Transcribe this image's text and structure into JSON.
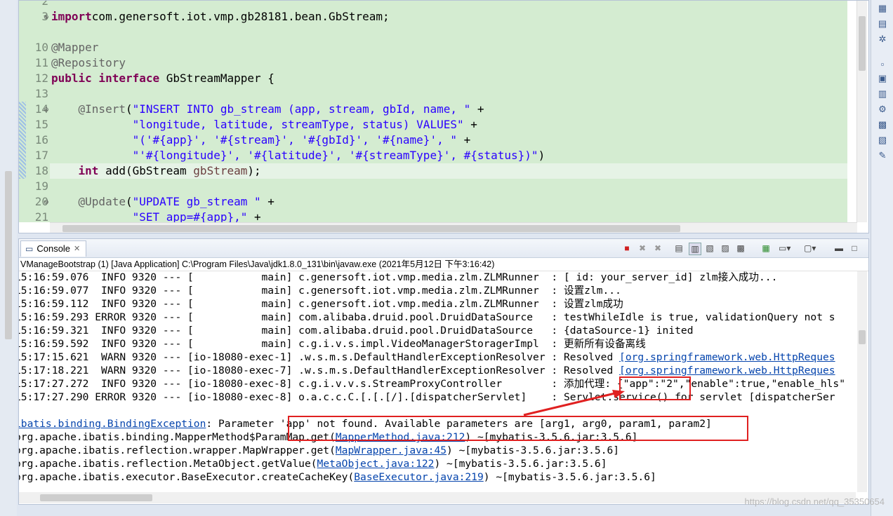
{
  "editor": {
    "lines": [
      {
        "num": "2",
        "html": ""
      },
      {
        "num": "3",
        "fold": "+",
        "parts": [
          [
            "kw",
            "import"
          ],
          [
            "",
            "com.genersoft.iot.vmp.gb28181.bean.GbStream;"
          ]
        ]
      },
      {
        "num": "",
        "parts": []
      },
      {
        "num": "10",
        "parts": [
          [
            "ann",
            "@Mapper"
          ]
        ]
      },
      {
        "num": "11",
        "parts": [
          [
            "ann",
            "@Repository"
          ]
        ]
      },
      {
        "num": "12",
        "parts": [
          [
            "kw",
            "public interface"
          ],
          [
            "",
            " GbStreamMapper {"
          ]
        ]
      },
      {
        "num": "13",
        "parts": []
      },
      {
        "num": "14",
        "fold": "-",
        "parts": [
          [
            "",
            "    "
          ],
          [
            "ann",
            "@Insert"
          ],
          [
            "",
            "("
          ],
          [
            "str",
            "\"INSERT INTO gb_stream (app, stream, gbId, name, \""
          ],
          [
            "",
            " +"
          ]
        ]
      },
      {
        "num": "15",
        "parts": [
          [
            "",
            "            "
          ],
          [
            "str",
            "\"longitude, latitude, streamType, status) VALUES\""
          ],
          [
            "",
            " +"
          ]
        ]
      },
      {
        "num": "16",
        "parts": [
          [
            "",
            "            "
          ],
          [
            "str",
            "\"('#{app}', '#{stream}', '#{gbId}', '#{name}', \""
          ],
          [
            "",
            " +"
          ]
        ]
      },
      {
        "num": "17",
        "parts": [
          [
            "",
            "            "
          ],
          [
            "str",
            "\"'#{longitude}', '#{latitude}', '#{streamType}', #{status})\""
          ],
          [
            "",
            ")"
          ]
        ]
      },
      {
        "num": "18",
        "parts": [
          [
            "",
            "    "
          ],
          [
            "kw",
            "int"
          ],
          [
            "",
            " add(GbStream "
          ],
          [
            "var",
            "gbStream"
          ],
          [
            "",
            ");"
          ]
        ]
      },
      {
        "num": "19",
        "parts": []
      },
      {
        "num": "20",
        "fold": "-",
        "parts": [
          [
            "",
            "    "
          ],
          [
            "ann",
            "@Update"
          ],
          [
            "",
            "("
          ],
          [
            "str",
            "\"UPDATE gb_stream \""
          ],
          [
            "",
            " +"
          ]
        ]
      },
      {
        "num": "21",
        "parts": [
          [
            "",
            "            "
          ],
          [
            "str",
            "\"SET app=#{app},\""
          ],
          [
            "",
            " +"
          ]
        ]
      }
    ]
  },
  "console": {
    "tab_label": "Console",
    "description": "VManageBootstrap (1) [Java Application] C:\\Program Files\\Java\\jdk1.8.0_131\\bin\\javaw.exe (2021年5月12日 下午3:16:42)",
    "log_lines": [
      {
        "parts": [
          [
            "",
            "15:16:59.076  INFO 9320 --- [           main] c.genersoft.iot.vmp.media.zlm.ZLMRunner  : [ id: your_server_id] zlm接入成功..."
          ]
        ]
      },
      {
        "parts": [
          [
            "",
            "15:16:59.077  INFO 9320 --- [           main] c.genersoft.iot.vmp.media.zlm.ZLMRunner  : 设置zlm..."
          ]
        ]
      },
      {
        "parts": [
          [
            "",
            "15:16:59.112  INFO 9320 --- [           main] c.genersoft.iot.vmp.media.zlm.ZLMRunner  : 设置zlm成功"
          ]
        ]
      },
      {
        "parts": [
          [
            "",
            "15:16:59.293 ERROR 9320 --- [           main] com.alibaba.druid.pool.DruidDataSource   : testWhileIdle is true, validationQuery not s"
          ]
        ]
      },
      {
        "parts": [
          [
            "",
            "15:16:59.321  INFO 9320 --- [           main] com.alibaba.druid.pool.DruidDataSource   : {dataSource-1} inited"
          ]
        ]
      },
      {
        "parts": [
          [
            "",
            "15:16:59.592  INFO 9320 --- [           main] c.g.i.v.s.impl.VideoManagerStoragerImpl  : 更新所有设备离线"
          ]
        ]
      },
      {
        "parts": [
          [
            "",
            "15:17:15.621  WARN 9320 --- [io-18080-exec-1] .w.s.m.s.DefaultHandlerExceptionResolver : Resolved "
          ],
          [
            "link",
            "[org.springframework.web.HttpReques"
          ]
        ]
      },
      {
        "parts": [
          [
            "",
            "15:17:18.221  WARN 9320 --- [io-18080-exec-7] .w.s.m.s.DefaultHandlerExceptionResolver : Resolved "
          ],
          [
            "link",
            "[org.springframework.web.HttpReques"
          ]
        ]
      },
      {
        "parts": [
          [
            "",
            "15:17:27.272  INFO 9320 --- [io-18080-exec-8] c.g.i.v.v.s.StreamProxyController        : 添加代理: {\"app\":\"2\",\"enable\":true,\"enable_hls\""
          ]
        ]
      },
      {
        "parts": [
          [
            "",
            "15:17:27.290 ERROR 9320 --- [io-18080-exec-8] o.a.c.c.C.[.[.[/].[dispatcherServlet]    : Servlet.service() for servlet [dispatcherSer"
          ]
        ]
      },
      {
        "parts": []
      },
      {
        "parts": [
          [
            "link",
            "ibatis.binding.BindingException"
          ],
          [
            "",
            ": Parameter 'app' not found. Available parameters are [arg1, arg0, param1, param2]"
          ]
        ]
      },
      {
        "parts": [
          [
            "",
            "org.apache.ibatis.binding.MapperMethod$ParamMap.get("
          ],
          [
            "link",
            "MapperMethod.java:212"
          ],
          [
            "",
            ") ~[mybatis-3.5.6.jar:3.5.6]"
          ]
        ]
      },
      {
        "parts": [
          [
            "",
            "org.apache.ibatis.reflection.wrapper.MapWrapper.get("
          ],
          [
            "link",
            "MapWrapper.java:45"
          ],
          [
            "",
            ") ~[mybatis-3.5.6.jar:3.5.6]"
          ]
        ]
      },
      {
        "parts": [
          [
            "",
            "org.apache.ibatis.reflection.MetaObject.getValue("
          ],
          [
            "link",
            "MetaObject.java:122"
          ],
          [
            "",
            ") ~[mybatis-3.5.6.jar:3.5.6]"
          ]
        ]
      },
      {
        "parts": [
          [
            "",
            "org.apache.ibatis.executor.BaseExecutor.createCacheKey("
          ],
          [
            "link",
            "BaseExecutor.java:219"
          ],
          [
            "",
            ") ~[mybatis-3.5.6.jar:3.5.6]"
          ]
        ]
      }
    ]
  },
  "watermark": "https://blog.csdn.net/qq_35350654",
  "colors": {
    "annotation_box": "#e02020",
    "editor_bg": "#d4ecd1"
  }
}
